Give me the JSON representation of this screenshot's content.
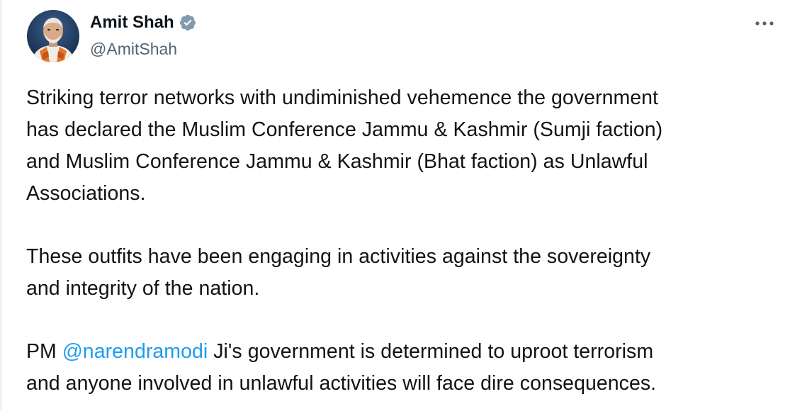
{
  "author": {
    "display_name": "Amit Shah",
    "handle": "@AmitShah",
    "verified": true,
    "verified_color": "#829aab",
    "avatar_icon": "profile-photo"
  },
  "menu": {
    "more_icon": "more-horizontal-icon"
  },
  "tweet": {
    "paragraph_1": {
      "line_1": "Striking terror networks with undiminished vehemence the government",
      "line_2": "has declared the Muslim Conference Jammu & Kashmir (Sumji faction)",
      "line_3": "and Muslim Conference Jammu & Kashmir (Bhat faction) as Unlawful",
      "line_4": "Associations."
    },
    "paragraph_2": {
      "line_1": "These outfits have been engaging in activities against the sovereignty",
      "line_2": "and integrity of the nation."
    },
    "paragraph_3": {
      "line_1_prefix": "PM ",
      "mention": "@narendramodi",
      "line_1_suffix": " Ji's government is determined to uproot terrorism",
      "line_2": "and anyone involved in unlawful activities will face dire consequences."
    }
  },
  "colors": {
    "text": "#0f1419",
    "secondary": "#536471",
    "link": "#1d9bf0"
  }
}
